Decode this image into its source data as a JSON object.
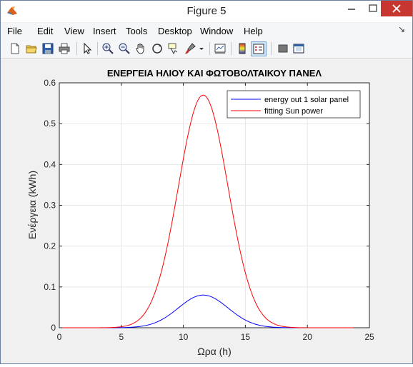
{
  "window": {
    "title": "Figure 5"
  },
  "menu": [
    "File",
    "Edit",
    "View",
    "Insert",
    "Tools",
    "Desktop",
    "Window",
    "Help"
  ],
  "toolbar": [
    "new-figure-icon",
    "open-file-icon",
    "save-icon",
    "print-icon",
    "edit-plot-arrow-icon",
    "zoom-in-icon",
    "zoom-out-icon",
    "pan-hand-icon",
    "rotate-3d-icon",
    "data-cursor-icon",
    "brush-icon",
    "brush-dropdown-icon",
    "link-plot-icon",
    "insert-colorbar-icon",
    "insert-legend-icon",
    "hide-plot-tools-icon",
    "show-plot-tools-icon"
  ],
  "chart_data": {
    "type": "line",
    "title": "ΕΝΕΡΓΕΙΑ ΗΛΙΟΥ ΚΑΙ ΦΩΤΟΒΟΛΤΑΙΚΟΥ ΠΑΝΕΛ",
    "xlabel": "Ωρα (h)",
    "ylabel": "Ενέργεια (kWh)",
    "xlim": [
      0,
      25
    ],
    "ylim": [
      0,
      0.6
    ],
    "xticks": [
      "0",
      "5",
      "10",
      "15",
      "20",
      "25"
    ],
    "yticks": [
      "0",
      "0.1",
      "0.2",
      "0.3",
      "0.4",
      "0.5",
      "0.6"
    ],
    "grid": true,
    "legend_position": "top-right",
    "x_range": [
      0,
      23.7
    ],
    "series": [
      {
        "name": "energy out 1 solar panel",
        "color": "#0000ff",
        "peak_x": 11.6,
        "peak_y": 0.08,
        "sigma": 2.0
      },
      {
        "name": "fitting Sun power",
        "color": "#ff0000",
        "peak_x": 11.6,
        "peak_y": 0.57,
        "sigma": 2.0
      }
    ]
  }
}
